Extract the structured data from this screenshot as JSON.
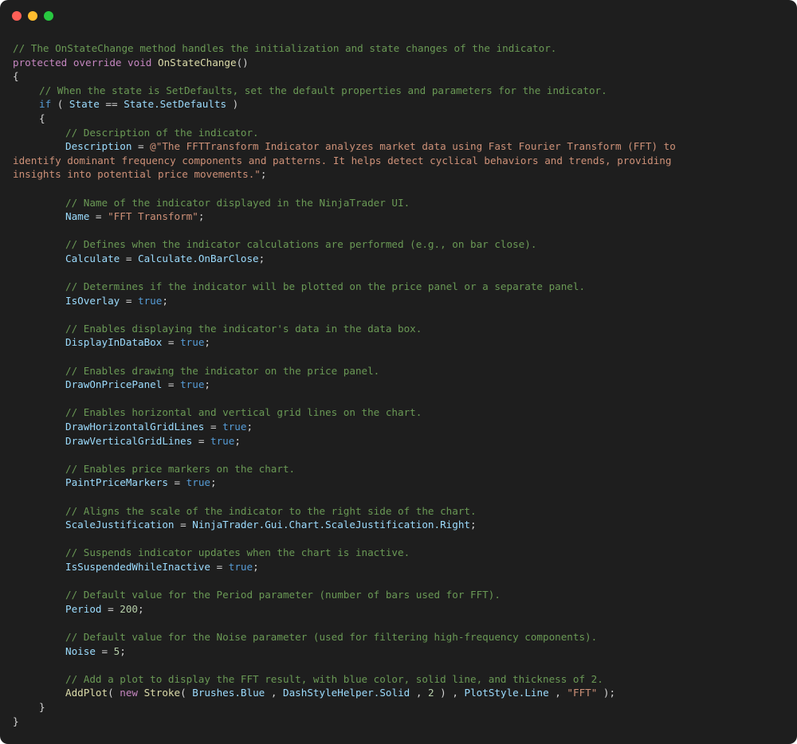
{
  "window": {
    "title_dots": {
      "close_color": "#ff5f57",
      "minimize_color": "#febc2e",
      "maximize_color": "#28c840"
    }
  },
  "theme": {
    "background": "#1e1e1e",
    "comment": "#6a9955",
    "keyword": "#c586c0",
    "function": "#dcdcaa",
    "identifier": "#9cdcfe",
    "string": "#ce9178",
    "number": "#b5cea8"
  },
  "code": {
    "lines": [
      {
        "indent": 0,
        "tokens": [
          {
            "type": "comment",
            "text": "// The OnStateChange method handles the initialization and state changes of the indicator."
          }
        ]
      },
      {
        "indent": 0,
        "tokens": [
          {
            "type": "keyword",
            "text": "protected override void "
          },
          {
            "type": "func",
            "text": "OnStateChange"
          },
          {
            "type": "plain",
            "text": "()"
          }
        ]
      },
      {
        "indent": 0,
        "tokens": [
          {
            "type": "plain",
            "text": "{"
          }
        ]
      },
      {
        "indent": 1,
        "tokens": [
          {
            "type": "comment",
            "text": "// When the state is SetDefaults, set the default properties and parameters for the indicator."
          }
        ]
      },
      {
        "indent": 1,
        "tokens": [
          {
            "type": "kw-blue",
            "text": "if"
          },
          {
            "type": "plain",
            "text": " ( "
          },
          {
            "type": "ident",
            "text": "State"
          },
          {
            "type": "plain",
            "text": " == "
          },
          {
            "type": "ident",
            "text": "State.SetDefaults"
          },
          {
            "type": "plain",
            "text": " )"
          }
        ]
      },
      {
        "indent": 1,
        "tokens": [
          {
            "type": "plain",
            "text": "{"
          }
        ]
      },
      {
        "indent": 2,
        "tokens": [
          {
            "type": "comment",
            "text": "// Description of the indicator."
          }
        ]
      },
      {
        "indent": 2,
        "tokens": [
          {
            "type": "ident",
            "text": "Description"
          },
          {
            "type": "plain",
            "text": " = "
          },
          {
            "type": "string",
            "text": "@\"The FFTTransform Indicator analyzes market data using Fast Fourier Transform (FFT) to"
          }
        ]
      },
      {
        "indent": 0,
        "tokens": [
          {
            "type": "string",
            "text": "identify dominant frequency components and patterns. It helps detect cyclical behaviors and trends, providing"
          }
        ]
      },
      {
        "indent": 0,
        "tokens": [
          {
            "type": "string",
            "text": "insights into potential price movements.\""
          },
          {
            "type": "plain",
            "text": ";"
          }
        ]
      },
      {
        "indent": 0,
        "tokens": []
      },
      {
        "indent": 2,
        "tokens": [
          {
            "type": "comment",
            "text": "// Name of the indicator displayed in the NinjaTrader UI."
          }
        ]
      },
      {
        "indent": 2,
        "tokens": [
          {
            "type": "ident",
            "text": "Name"
          },
          {
            "type": "plain",
            "text": " = "
          },
          {
            "type": "string",
            "text": "\"FFT Transform\""
          },
          {
            "type": "plain",
            "text": ";"
          }
        ]
      },
      {
        "indent": 0,
        "tokens": []
      },
      {
        "indent": 2,
        "tokens": [
          {
            "type": "comment",
            "text": "// Defines when the indicator calculations are performed (e.g., on bar close)."
          }
        ]
      },
      {
        "indent": 2,
        "tokens": [
          {
            "type": "ident",
            "text": "Calculate"
          },
          {
            "type": "plain",
            "text": " = "
          },
          {
            "type": "ident",
            "text": "Calculate.OnBarClose"
          },
          {
            "type": "plain",
            "text": ";"
          }
        ]
      },
      {
        "indent": 0,
        "tokens": []
      },
      {
        "indent": 2,
        "tokens": [
          {
            "type": "comment",
            "text": "// Determines if the indicator will be plotted on the price panel or a separate panel."
          }
        ]
      },
      {
        "indent": 2,
        "tokens": [
          {
            "type": "ident",
            "text": "IsOverlay"
          },
          {
            "type": "plain",
            "text": " = "
          },
          {
            "type": "kw-blue",
            "text": "true"
          },
          {
            "type": "plain",
            "text": ";"
          }
        ]
      },
      {
        "indent": 0,
        "tokens": []
      },
      {
        "indent": 2,
        "tokens": [
          {
            "type": "comment",
            "text": "// Enables displaying the indicator's data in the data box."
          }
        ]
      },
      {
        "indent": 2,
        "tokens": [
          {
            "type": "ident",
            "text": "DisplayInDataBox"
          },
          {
            "type": "plain",
            "text": " = "
          },
          {
            "type": "kw-blue",
            "text": "true"
          },
          {
            "type": "plain",
            "text": ";"
          }
        ]
      },
      {
        "indent": 0,
        "tokens": []
      },
      {
        "indent": 2,
        "tokens": [
          {
            "type": "comment",
            "text": "// Enables drawing the indicator on the price panel."
          }
        ]
      },
      {
        "indent": 2,
        "tokens": [
          {
            "type": "ident",
            "text": "DrawOnPricePanel"
          },
          {
            "type": "plain",
            "text": " = "
          },
          {
            "type": "kw-blue",
            "text": "true"
          },
          {
            "type": "plain",
            "text": ";"
          }
        ]
      },
      {
        "indent": 0,
        "tokens": []
      },
      {
        "indent": 2,
        "tokens": [
          {
            "type": "comment",
            "text": "// Enables horizontal and vertical grid lines on the chart."
          }
        ]
      },
      {
        "indent": 2,
        "tokens": [
          {
            "type": "ident",
            "text": "DrawHorizontalGridLines"
          },
          {
            "type": "plain",
            "text": " = "
          },
          {
            "type": "kw-blue",
            "text": "true"
          },
          {
            "type": "plain",
            "text": ";"
          }
        ]
      },
      {
        "indent": 2,
        "tokens": [
          {
            "type": "ident",
            "text": "DrawVerticalGridLines"
          },
          {
            "type": "plain",
            "text": " = "
          },
          {
            "type": "kw-blue",
            "text": "true"
          },
          {
            "type": "plain",
            "text": ";"
          }
        ]
      },
      {
        "indent": 0,
        "tokens": []
      },
      {
        "indent": 2,
        "tokens": [
          {
            "type": "comment",
            "text": "// Enables price markers on the chart."
          }
        ]
      },
      {
        "indent": 2,
        "tokens": [
          {
            "type": "ident",
            "text": "PaintPriceMarkers"
          },
          {
            "type": "plain",
            "text": " = "
          },
          {
            "type": "kw-blue",
            "text": "true"
          },
          {
            "type": "plain",
            "text": ";"
          }
        ]
      },
      {
        "indent": 0,
        "tokens": []
      },
      {
        "indent": 2,
        "tokens": [
          {
            "type": "comment",
            "text": "// Aligns the scale of the indicator to the right side of the chart."
          }
        ]
      },
      {
        "indent": 2,
        "tokens": [
          {
            "type": "ident",
            "text": "ScaleJustification"
          },
          {
            "type": "plain",
            "text": " = "
          },
          {
            "type": "ident",
            "text": "NinjaTrader.Gui.Chart.ScaleJustification.Right"
          },
          {
            "type": "plain",
            "text": ";"
          }
        ]
      },
      {
        "indent": 0,
        "tokens": []
      },
      {
        "indent": 2,
        "tokens": [
          {
            "type": "comment",
            "text": "// Suspends indicator updates when the chart is inactive."
          }
        ]
      },
      {
        "indent": 2,
        "tokens": [
          {
            "type": "ident",
            "text": "IsSuspendedWhileInactive"
          },
          {
            "type": "plain",
            "text": " = "
          },
          {
            "type": "kw-blue",
            "text": "true"
          },
          {
            "type": "plain",
            "text": ";"
          }
        ]
      },
      {
        "indent": 0,
        "tokens": []
      },
      {
        "indent": 2,
        "tokens": [
          {
            "type": "comment",
            "text": "// Default value for the Period parameter (number of bars used for FFT)."
          }
        ]
      },
      {
        "indent": 2,
        "tokens": [
          {
            "type": "ident",
            "text": "Period"
          },
          {
            "type": "plain",
            "text": " = "
          },
          {
            "type": "number",
            "text": "200"
          },
          {
            "type": "plain",
            "text": ";"
          }
        ]
      },
      {
        "indent": 0,
        "tokens": []
      },
      {
        "indent": 2,
        "tokens": [
          {
            "type": "comment",
            "text": "// Default value for the Noise parameter (used for filtering high-frequency components)."
          }
        ]
      },
      {
        "indent": 2,
        "tokens": [
          {
            "type": "ident",
            "text": "Noise"
          },
          {
            "type": "plain",
            "text": " = "
          },
          {
            "type": "number",
            "text": "5"
          },
          {
            "type": "plain",
            "text": ";"
          }
        ]
      },
      {
        "indent": 0,
        "tokens": []
      },
      {
        "indent": 2,
        "tokens": [
          {
            "type": "comment",
            "text": "// Add a plot to display the FFT result, with blue color, solid line, and thickness of 2."
          }
        ]
      },
      {
        "indent": 2,
        "tokens": [
          {
            "type": "func",
            "text": "AddPlot"
          },
          {
            "type": "plain",
            "text": "( "
          },
          {
            "type": "keyword",
            "text": "new"
          },
          {
            "type": "plain",
            "text": " "
          },
          {
            "type": "func",
            "text": "Stroke"
          },
          {
            "type": "plain",
            "text": "( "
          },
          {
            "type": "ident",
            "text": "Brushes.Blue"
          },
          {
            "type": "plain",
            "text": " , "
          },
          {
            "type": "ident",
            "text": "DashStyleHelper.Solid"
          },
          {
            "type": "plain",
            "text": " , "
          },
          {
            "type": "number",
            "text": "2"
          },
          {
            "type": "plain",
            "text": " ) , "
          },
          {
            "type": "ident",
            "text": "PlotStyle.Line"
          },
          {
            "type": "plain",
            "text": " , "
          },
          {
            "type": "string",
            "text": "\"FFT\""
          },
          {
            "type": "plain",
            "text": " );"
          }
        ]
      },
      {
        "indent": 1,
        "tokens": [
          {
            "type": "plain",
            "text": "}"
          }
        ]
      },
      {
        "indent": 0,
        "tokens": [
          {
            "type": "plain",
            "text": "}"
          }
        ]
      }
    ]
  }
}
